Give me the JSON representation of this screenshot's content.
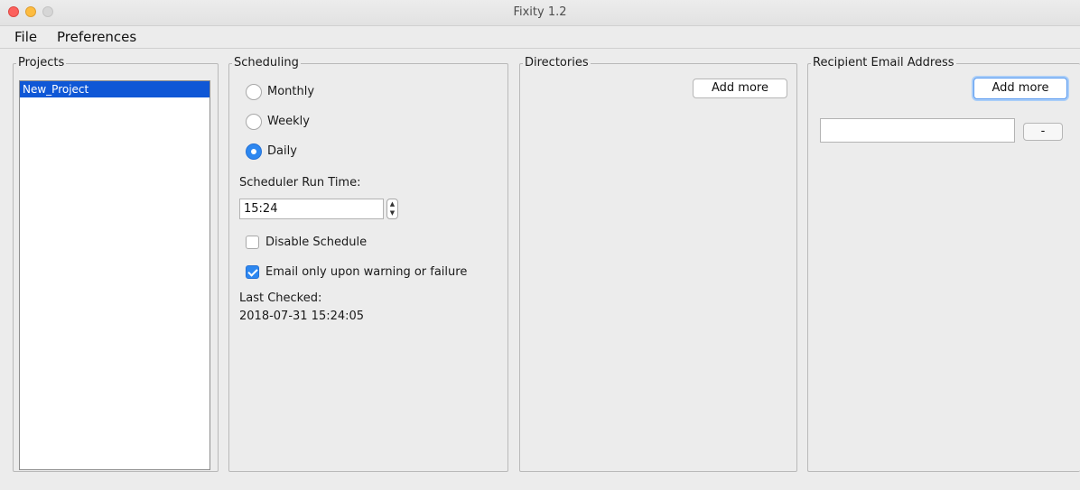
{
  "window": {
    "title": "Fixity 1.2"
  },
  "menu": {
    "file": "File",
    "preferences": "Preferences"
  },
  "projects": {
    "legend": "Projects",
    "items": [
      "New_Project"
    ]
  },
  "scheduling": {
    "legend": "Scheduling",
    "frequency_options": [
      "Monthly",
      "Weekly",
      "Daily"
    ],
    "selected_frequency": "Daily",
    "run_time_label": "Scheduler Run Time:",
    "run_time_value": "15:24",
    "disable_schedule_label": "Disable Schedule",
    "disable_schedule_checked": false,
    "email_only_label": "Email only upon warning or failure",
    "email_only_checked": true,
    "last_checked_label": "Last Checked:",
    "last_checked_value": "2018-07-31 15:24:05"
  },
  "directories": {
    "legend": "Directories",
    "add_more_label": "Add more"
  },
  "recipients": {
    "legend": "Recipient Email Address",
    "add_more_label": "Add more",
    "email_value": "",
    "remove_label": "-"
  },
  "colors": {
    "selection": "#0f57d6",
    "accent": "#2d87f0"
  },
  "icons": {
    "window_controls": [
      "close-dot",
      "minimize-dot",
      "maximize-dot"
    ],
    "stepper": "up-down-arrows-icon"
  }
}
